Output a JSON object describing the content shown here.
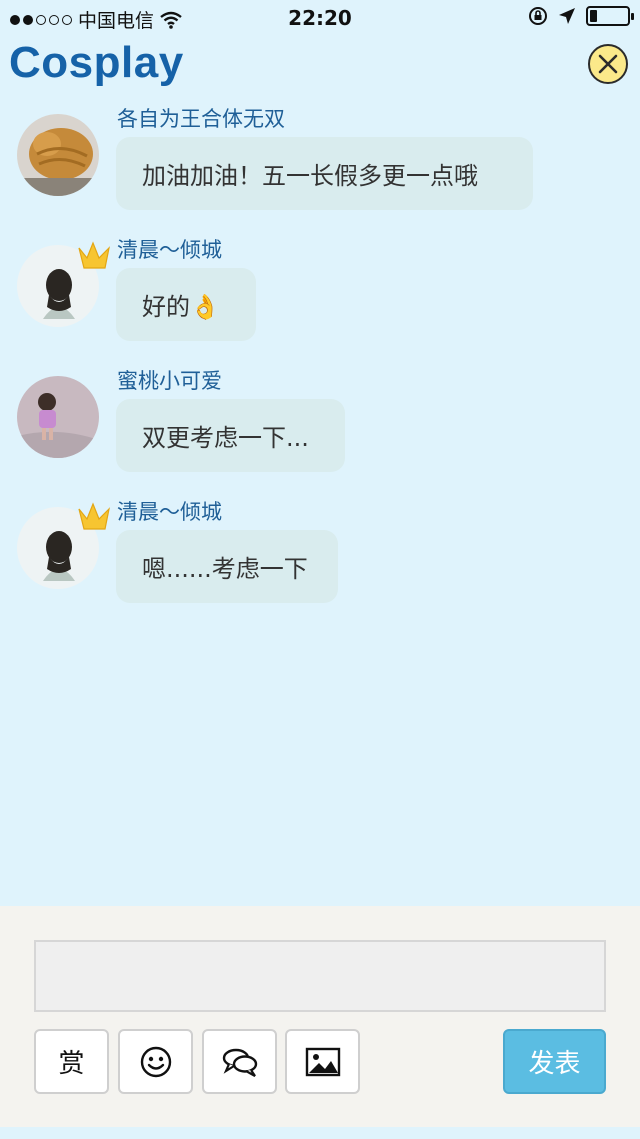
{
  "status_bar": {
    "carrier": "中国电信",
    "time": "22:20",
    "signal_bars_filled": 2,
    "signal_bars_total": 5,
    "battery_level": 0.2
  },
  "header": {
    "title": "Cosplay",
    "close_icon": "close-icon",
    "close_color": "#fbe98a"
  },
  "messages": [
    {
      "user": "各自为王合体无双",
      "text": "加油加油！五一长假多更一点哦",
      "crown": false
    },
    {
      "user": "清晨～倾城",
      "text": "好的👌",
      "crown": true
    },
    {
      "user": "蜜桃小可爱",
      "text": "双更考虑一下...",
      "crown": false
    },
    {
      "user": "清晨～倾城",
      "text": "嗯......考虑一下",
      "crown": true
    }
  ],
  "composer": {
    "input_value": "",
    "reward_label": "赏",
    "emoji_icon": "smiley-icon",
    "chat_icon": "chat-bubbles-icon",
    "image_icon": "image-icon",
    "send_label": "发表"
  },
  "colors": {
    "accent": "#1662a8",
    "background": "#dff3fc",
    "bubble": "#d9ecee",
    "send_button": "#5bbde2"
  }
}
